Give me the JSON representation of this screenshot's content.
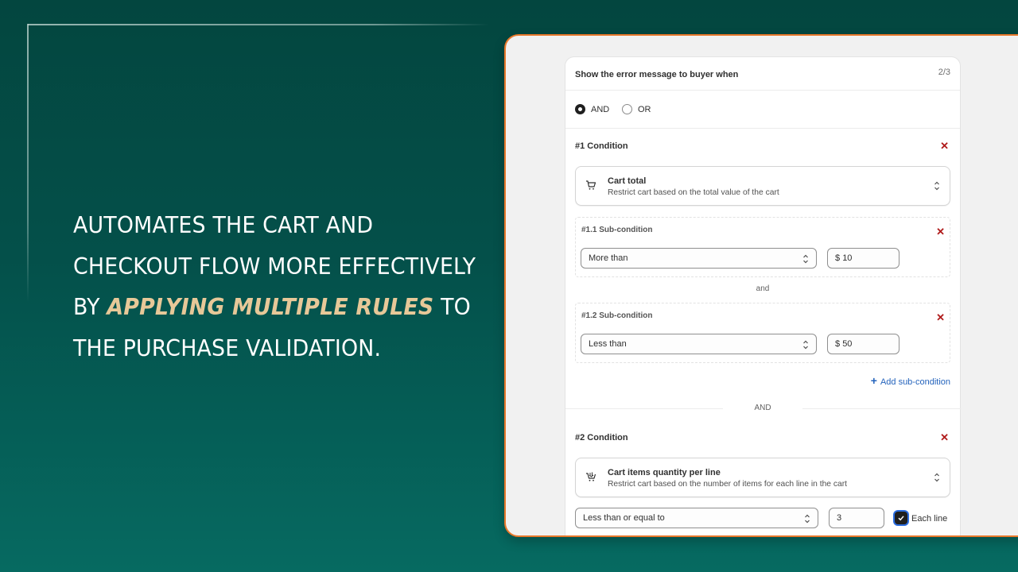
{
  "headline": {
    "line1": "AUTOMATES THE CART AND",
    "line2": "CHECKOUT FLOW MORE EFFECTIVELY",
    "line3_pre": "BY ",
    "line3_highlight": "APPLYING MULTIPLE RULES",
    "line3_post": " TO",
    "line4": "THE PURCHASE VALIDATION."
  },
  "colors": {
    "accent_orange": "#e8782a",
    "highlight_text": "#e7c898",
    "link_blue": "#2463bc",
    "remove_red": "#b01b1b"
  },
  "card": {
    "title": "Show the error message to buyer when",
    "step": "2/3",
    "logic_options": [
      {
        "label": "AND",
        "selected": true
      },
      {
        "label": "OR",
        "selected": false
      }
    ],
    "conditions": [
      {
        "heading": "#1 Condition",
        "remove_icon": "close-icon",
        "type_title": "Cart total",
        "type_description": "Restrict cart based on the total value of the cart",
        "type_icon": "cart-icon",
        "sub_conditions": [
          {
            "heading": "#1.1 Sub-condition",
            "operator": "More than",
            "currency": "$",
            "value": "10"
          },
          {
            "heading": "#1.2 Sub-condition",
            "operator": "Less than",
            "currency": "$",
            "value": "50"
          }
        ],
        "sub_joiner": "and",
        "add_sub_label": "Add sub-condition"
      },
      {
        "heading": "#2 Condition",
        "remove_icon": "close-icon",
        "type_title": "Cart items quantity per line",
        "type_description": "Restrict cart based on the number of items for each line in the cart",
        "type_icon": "cart-items-icon",
        "operator": "Less than or equal to",
        "value": "3",
        "each_line_label": "Each line",
        "each_line_checked": true
      }
    ],
    "condition_joiner": "AND"
  }
}
